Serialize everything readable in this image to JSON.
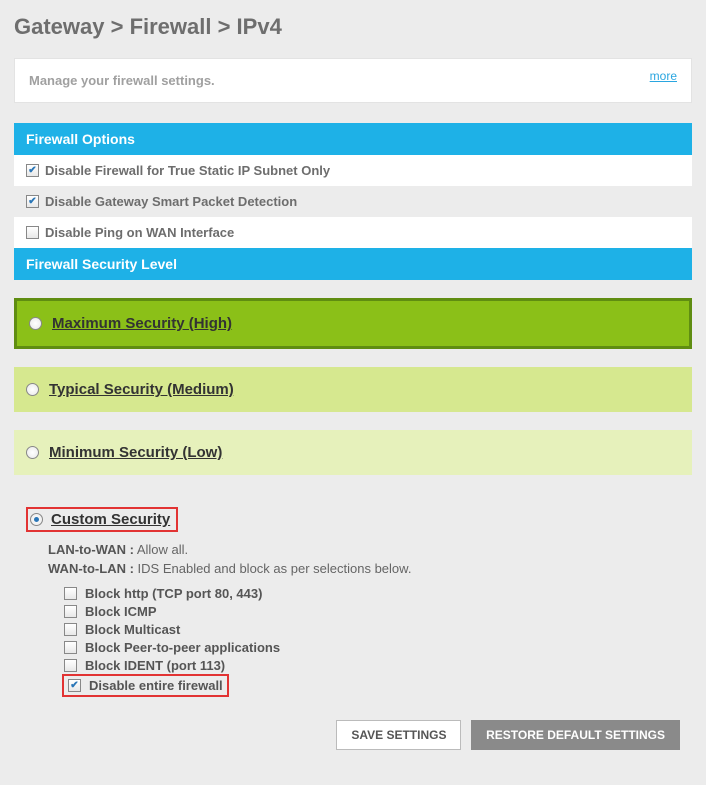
{
  "breadcrumb": "Gateway > Firewall > IPv4",
  "desc": "Manage your firewall settings.",
  "more": "more",
  "sections": {
    "options_header": "Firewall Options",
    "opts": [
      {
        "label": "Disable Firewall for True Static IP Subnet Only",
        "checked": true
      },
      {
        "label": "Disable Gateway Smart Packet Detection",
        "checked": true
      },
      {
        "label": "Disable Ping on WAN Interface",
        "checked": false
      }
    ],
    "level_header": "Firewall Security Level",
    "levels": {
      "high": "Maximum Security (High)",
      "med": "Typical Security (Medium)",
      "low": "Minimum Security (Low)",
      "custom": "Custom Security"
    },
    "custom": {
      "lan_label": "LAN-to-WAN :",
      "lan_val": "Allow all.",
      "wan_label": "WAN-to-LAN :",
      "wan_val": "IDS Enabled and block as per selections below.",
      "subs": [
        {
          "label": "Block http (TCP port 80, 443)",
          "checked": false
        },
        {
          "label": "Block ICMP",
          "checked": false
        },
        {
          "label": "Block Multicast",
          "checked": false
        },
        {
          "label": "Block Peer-to-peer applications",
          "checked": false
        },
        {
          "label": "Block IDENT (port 113)",
          "checked": false
        },
        {
          "label": "Disable entire firewall",
          "checked": true,
          "highlight": true
        }
      ]
    }
  },
  "buttons": {
    "save": "SAVE SETTINGS",
    "restore": "RESTORE DEFAULT SETTINGS"
  }
}
